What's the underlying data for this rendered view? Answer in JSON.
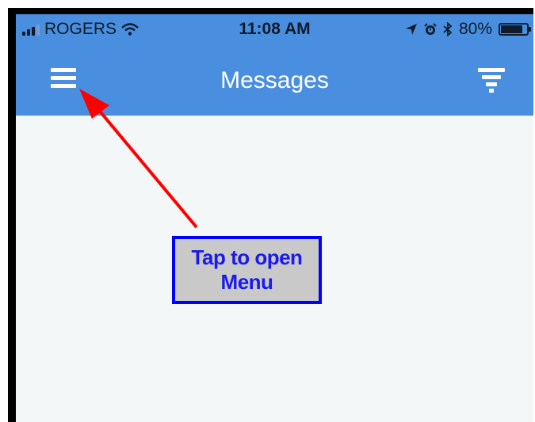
{
  "status_bar": {
    "carrier": "ROGERS",
    "time": "11:08 AM",
    "battery": "80%",
    "icons": [
      "signal-icon",
      "wifi-icon",
      "location-icon",
      "alarm-icon",
      "bluetooth-icon",
      "battery-icon"
    ]
  },
  "nav_bar": {
    "title": "Messages",
    "left_icon": "hamburger-menu-icon",
    "right_icon": "filter-icon"
  },
  "annotation": {
    "line1": "Tap to open",
    "line2": "Menu"
  },
  "colors": {
    "nav_bar": "#4a8fdf",
    "screen_background": "#f4f7f8",
    "arrow": "#ff0000",
    "callout_border": "#0000ff",
    "callout_text": "#1a1aee",
    "callout_fill": "#c9c9c9"
  }
}
